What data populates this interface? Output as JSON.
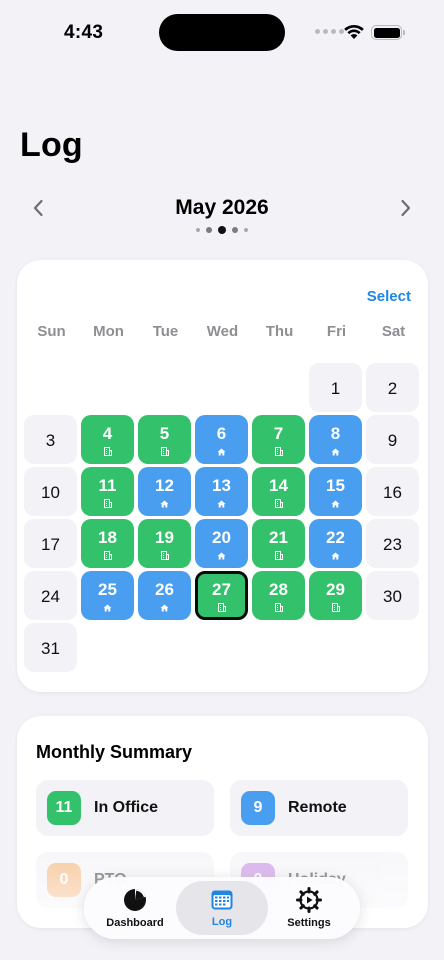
{
  "status": {
    "time": "4:43"
  },
  "title": "Log",
  "month": {
    "label": "May 2026"
  },
  "calendar": {
    "select_label": "Select",
    "weekdays": [
      "Sun",
      "Mon",
      "Tue",
      "Wed",
      "Thu",
      "Fri",
      "Sat"
    ],
    "days": [
      {
        "n": "",
        "t": "blank"
      },
      {
        "n": "",
        "t": "blank"
      },
      {
        "n": "",
        "t": "blank"
      },
      {
        "n": "",
        "t": "blank"
      },
      {
        "n": "",
        "t": "blank"
      },
      {
        "n": "1",
        "t": "plain"
      },
      {
        "n": "2",
        "t": "plain"
      },
      {
        "n": "3",
        "t": "plain"
      },
      {
        "n": "4",
        "t": "office"
      },
      {
        "n": "5",
        "t": "office"
      },
      {
        "n": "6",
        "t": "remote"
      },
      {
        "n": "7",
        "t": "office"
      },
      {
        "n": "8",
        "t": "remote"
      },
      {
        "n": "9",
        "t": "plain"
      },
      {
        "n": "10",
        "t": "plain"
      },
      {
        "n": "11",
        "t": "office"
      },
      {
        "n": "12",
        "t": "remote"
      },
      {
        "n": "13",
        "t": "remote"
      },
      {
        "n": "14",
        "t": "office"
      },
      {
        "n": "15",
        "t": "remote"
      },
      {
        "n": "16",
        "t": "plain"
      },
      {
        "n": "17",
        "t": "plain"
      },
      {
        "n": "18",
        "t": "office"
      },
      {
        "n": "19",
        "t": "office"
      },
      {
        "n": "20",
        "t": "remote"
      },
      {
        "n": "21",
        "t": "office"
      },
      {
        "n": "22",
        "t": "remote"
      },
      {
        "n": "23",
        "t": "plain"
      },
      {
        "n": "24",
        "t": "plain"
      },
      {
        "n": "25",
        "t": "remote"
      },
      {
        "n": "26",
        "t": "remote"
      },
      {
        "n": "27",
        "t": "office",
        "today": true
      },
      {
        "n": "28",
        "t": "office"
      },
      {
        "n": "29",
        "t": "office"
      },
      {
        "n": "30",
        "t": "plain"
      },
      {
        "n": "31",
        "t": "plain"
      }
    ]
  },
  "summary": {
    "title": "Monthly Summary",
    "stats": [
      {
        "count": "11",
        "label": "In Office",
        "color": "#34c16b"
      },
      {
        "count": "9",
        "label": "Remote",
        "color": "#4a9ef0"
      },
      {
        "count": "0",
        "label": "PTO",
        "color": "#f2a35a"
      },
      {
        "count": "0",
        "label": "Holiday",
        "color": "#b86ee0"
      }
    ]
  },
  "tabs": [
    {
      "label": "Dashboard",
      "icon": "pie-chart-icon"
    },
    {
      "label": "Log",
      "icon": "calendar-icon",
      "active": true
    },
    {
      "label": "Settings",
      "icon": "gear-icon"
    }
  ],
  "colors": {
    "office": "#34c16b",
    "remote": "#4a9ef0",
    "accent": "#1f86e6"
  }
}
